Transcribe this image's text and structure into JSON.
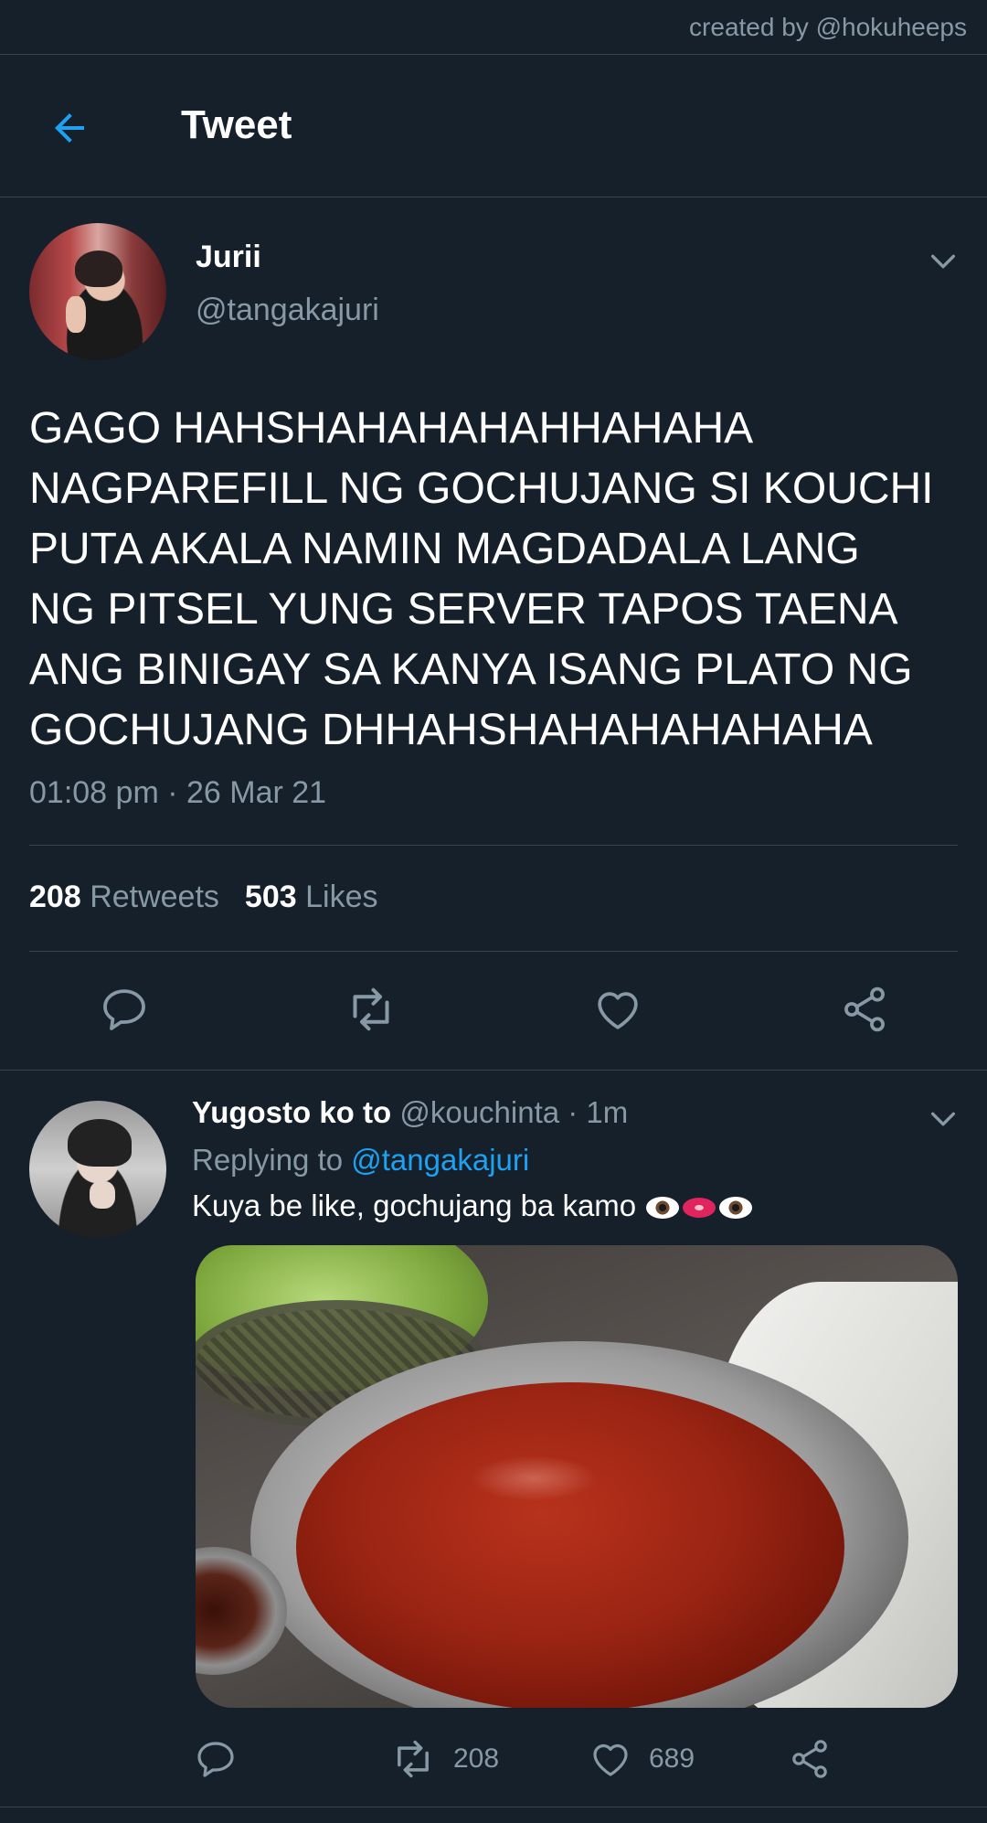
{
  "credit": "created by @hokuheeps",
  "header": {
    "title": "Tweet",
    "back_icon": "arrow-left-icon"
  },
  "tweet": {
    "author_name": "Jurii",
    "author_handle": "@tangakajuri",
    "text_lines": [
      "GAGO HAHSHAHAHAHAHHAHAHA",
      "NAGPAREFILL NG GOCHUJANG SI KOUCHI",
      "PUTA AKALA NAMIN MAGDADALA LANG",
      "NG PITSEL YUNG SERVER TAPOS TAENA",
      "ANG BINIGAY SA KANYA ISANG PLATO NG",
      "GOCHUJANG DHHAHSHAHAHAHAHAHA"
    ],
    "timestamp": "01:08 pm · 26 Mar 21",
    "retweets_count": "208",
    "retweets_label": "Retweets",
    "likes_count": "503",
    "likes_label": "Likes"
  },
  "reply": {
    "author_name": "Yugosto ko to",
    "meta": "@kouchinta · 1m",
    "replying_prefix": "Replying to ",
    "replying_handle": "@tangakajuri",
    "text": "Kuya be like, gochujang ba kamo",
    "emojis": [
      "eye-emoji",
      "lips-emoji",
      "eye-emoji"
    ],
    "retweet_count": "208",
    "like_count": "689"
  },
  "colors": {
    "background": "#15202b",
    "divider": "#38444d",
    "secondary_text": "#8899a6",
    "accent": "#1da1f2"
  }
}
